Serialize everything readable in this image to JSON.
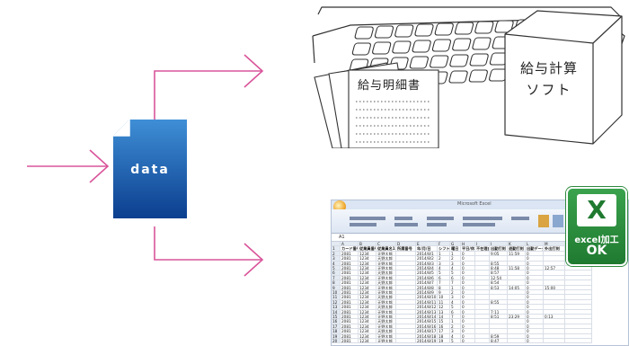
{
  "document_icon": {
    "label": "data"
  },
  "payslip": {
    "title": "給与明細書"
  },
  "software_box": {
    "line1": "給与計算",
    "line2": "ソフト"
  },
  "excel_badge": {
    "logo_letter": "X",
    "caption": "excel加工",
    "status": "OK"
  },
  "spreadsheet": {
    "window_title": "Microsoft Excel",
    "cell_ref": "A1",
    "column_letters": [
      "A",
      "B",
      "C",
      "D",
      "E",
      "F",
      "G",
      "H",
      "I",
      "J",
      "K",
      "L",
      "M",
      "N",
      "O"
    ],
    "header_cells": [
      "カード番号",
      "従業員番号",
      "従業員名1",
      "所属番号",
      "年/月/日",
      "シフト",
      "曜日",
      "平日/休日",
      "不在理由",
      "出勤打刻",
      "退勤打刻",
      "出勤データ",
      "外出打刻"
    ],
    "rows": [
      {
        "num": "1",
        "date": "2014/8/1",
        "in": "9:05",
        "out": "11:59",
        "extra": ""
      },
      {
        "num": "2",
        "date": "2014/8/2",
        "in": "",
        "out": "",
        "extra": ""
      },
      {
        "num": "3",
        "date": "2014/8/3",
        "in": "8:55",
        "out": "",
        "extra": ""
      },
      {
        "num": "4",
        "date": "2014/8/4",
        "in": "8:48",
        "out": "11:58",
        "extra": "12:57"
      },
      {
        "num": "5",
        "date": "2014/8/5",
        "in": "8:57",
        "out": "",
        "extra": ""
      },
      {
        "num": "6",
        "date": "2014/8/6",
        "in": "12:54",
        "out": "",
        "extra": ""
      },
      {
        "num": "7",
        "date": "2014/8/7",
        "in": "8:54",
        "out": "",
        "extra": ""
      },
      {
        "num": "8",
        "date": "2014/8/8",
        "in": "8:53",
        "out": "14:05",
        "extra": "15:00"
      },
      {
        "num": "9",
        "date": "2014/8/9",
        "in": "",
        "out": "",
        "extra": ""
      },
      {
        "num": "10",
        "date": "2014/8/10",
        "in": "",
        "out": "",
        "extra": ""
      },
      {
        "num": "11",
        "date": "2014/8/11",
        "in": "8:55",
        "out": "",
        "extra": ""
      },
      {
        "num": "12",
        "date": "2014/8/12",
        "in": "",
        "out": "",
        "extra": ""
      },
      {
        "num": "13",
        "date": "2014/8/13",
        "in": "7:11",
        "out": "",
        "extra": ""
      },
      {
        "num": "14",
        "date": "2014/8/14",
        "in": "8:51",
        "out": "23:29",
        "extra": "0:13"
      },
      {
        "num": "15",
        "date": "2014/8/15",
        "in": "",
        "out": "",
        "extra": ""
      },
      {
        "num": "16",
        "date": "2014/8/16",
        "in": "",
        "out": "",
        "extra": ""
      },
      {
        "num": "17",
        "date": "2014/8/17",
        "in": "",
        "out": "",
        "extra": ""
      },
      {
        "num": "18",
        "date": "2014/8/18",
        "in": "8:59",
        "out": "",
        "extra": ""
      },
      {
        "num": "19",
        "date": "2014/8/19",
        "in": "8:47",
        "out": "",
        "extra": ""
      }
    ],
    "row_constants": {
      "card": "2081",
      "emp_num": "1234",
      "emp_name": "天野太郎"
    }
  },
  "colors": {
    "arrow": "#d9559a",
    "doc_blue_light": "#3a86d0",
    "doc_blue_dark": "#0a3f91",
    "excel_green": "#2e8b3e",
    "excel_green_dark": "#1c6b2d"
  }
}
